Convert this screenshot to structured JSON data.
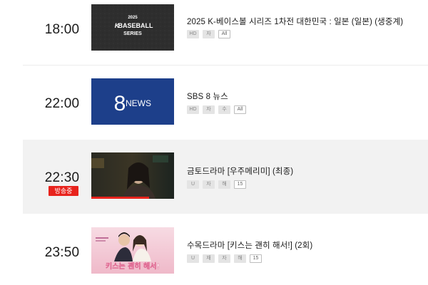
{
  "schedule": [
    {
      "time": "18:00",
      "live": false,
      "title": "2025 K-베이스볼 시리즈 1차전 대한민국 : 일본 (일본) (생중계)",
      "thumbnail": {
        "kind": "baseball",
        "year": "2025",
        "line1": "BASEBALL",
        "line2": "SERIES",
        "brand_mark": "K"
      },
      "badges": [
        {
          "label": "HD",
          "outline": false
        },
        {
          "label": "자",
          "outline": false
        },
        {
          "label": "All",
          "outline": true
        }
      ]
    },
    {
      "time": "22:00",
      "live": false,
      "title": "SBS 8 뉴스",
      "thumbnail": {
        "kind": "news",
        "numeral": "8",
        "word": "NEWS"
      },
      "badges": [
        {
          "label": "HD",
          "outline": false
        },
        {
          "label": "자",
          "outline": false
        },
        {
          "label": "수",
          "outline": false
        },
        {
          "label": "All",
          "outline": true
        }
      ]
    },
    {
      "time": "22:30",
      "live": true,
      "live_label": "방송중",
      "progress": 0.7,
      "title": "금토드라마 [우주메리미] (최종)",
      "thumbnail": {
        "kind": "drama"
      },
      "badges": [
        {
          "label": "U",
          "outline": false
        },
        {
          "label": "자",
          "outline": false
        },
        {
          "label": "해",
          "outline": false
        },
        {
          "label": "15",
          "outline": true
        }
      ]
    },
    {
      "time": "23:50",
      "live": false,
      "title": "수목드라마 [키스는 괜히 해서!] (2회)",
      "thumbnail": {
        "kind": "poster",
        "caption": "키스는 괜히 해서!"
      },
      "badges": [
        {
          "label": "U",
          "outline": false
        },
        {
          "label": "재",
          "outline": false
        },
        {
          "label": "자",
          "outline": false
        },
        {
          "label": "해",
          "outline": false
        },
        {
          "label": "15",
          "outline": true
        }
      ]
    }
  ],
  "colors": {
    "live_red": "#e8231d",
    "news_blue": "#1d3f8a",
    "baseball_bg": "#2b2b2b",
    "poster_pink": "#f4c9d6"
  }
}
